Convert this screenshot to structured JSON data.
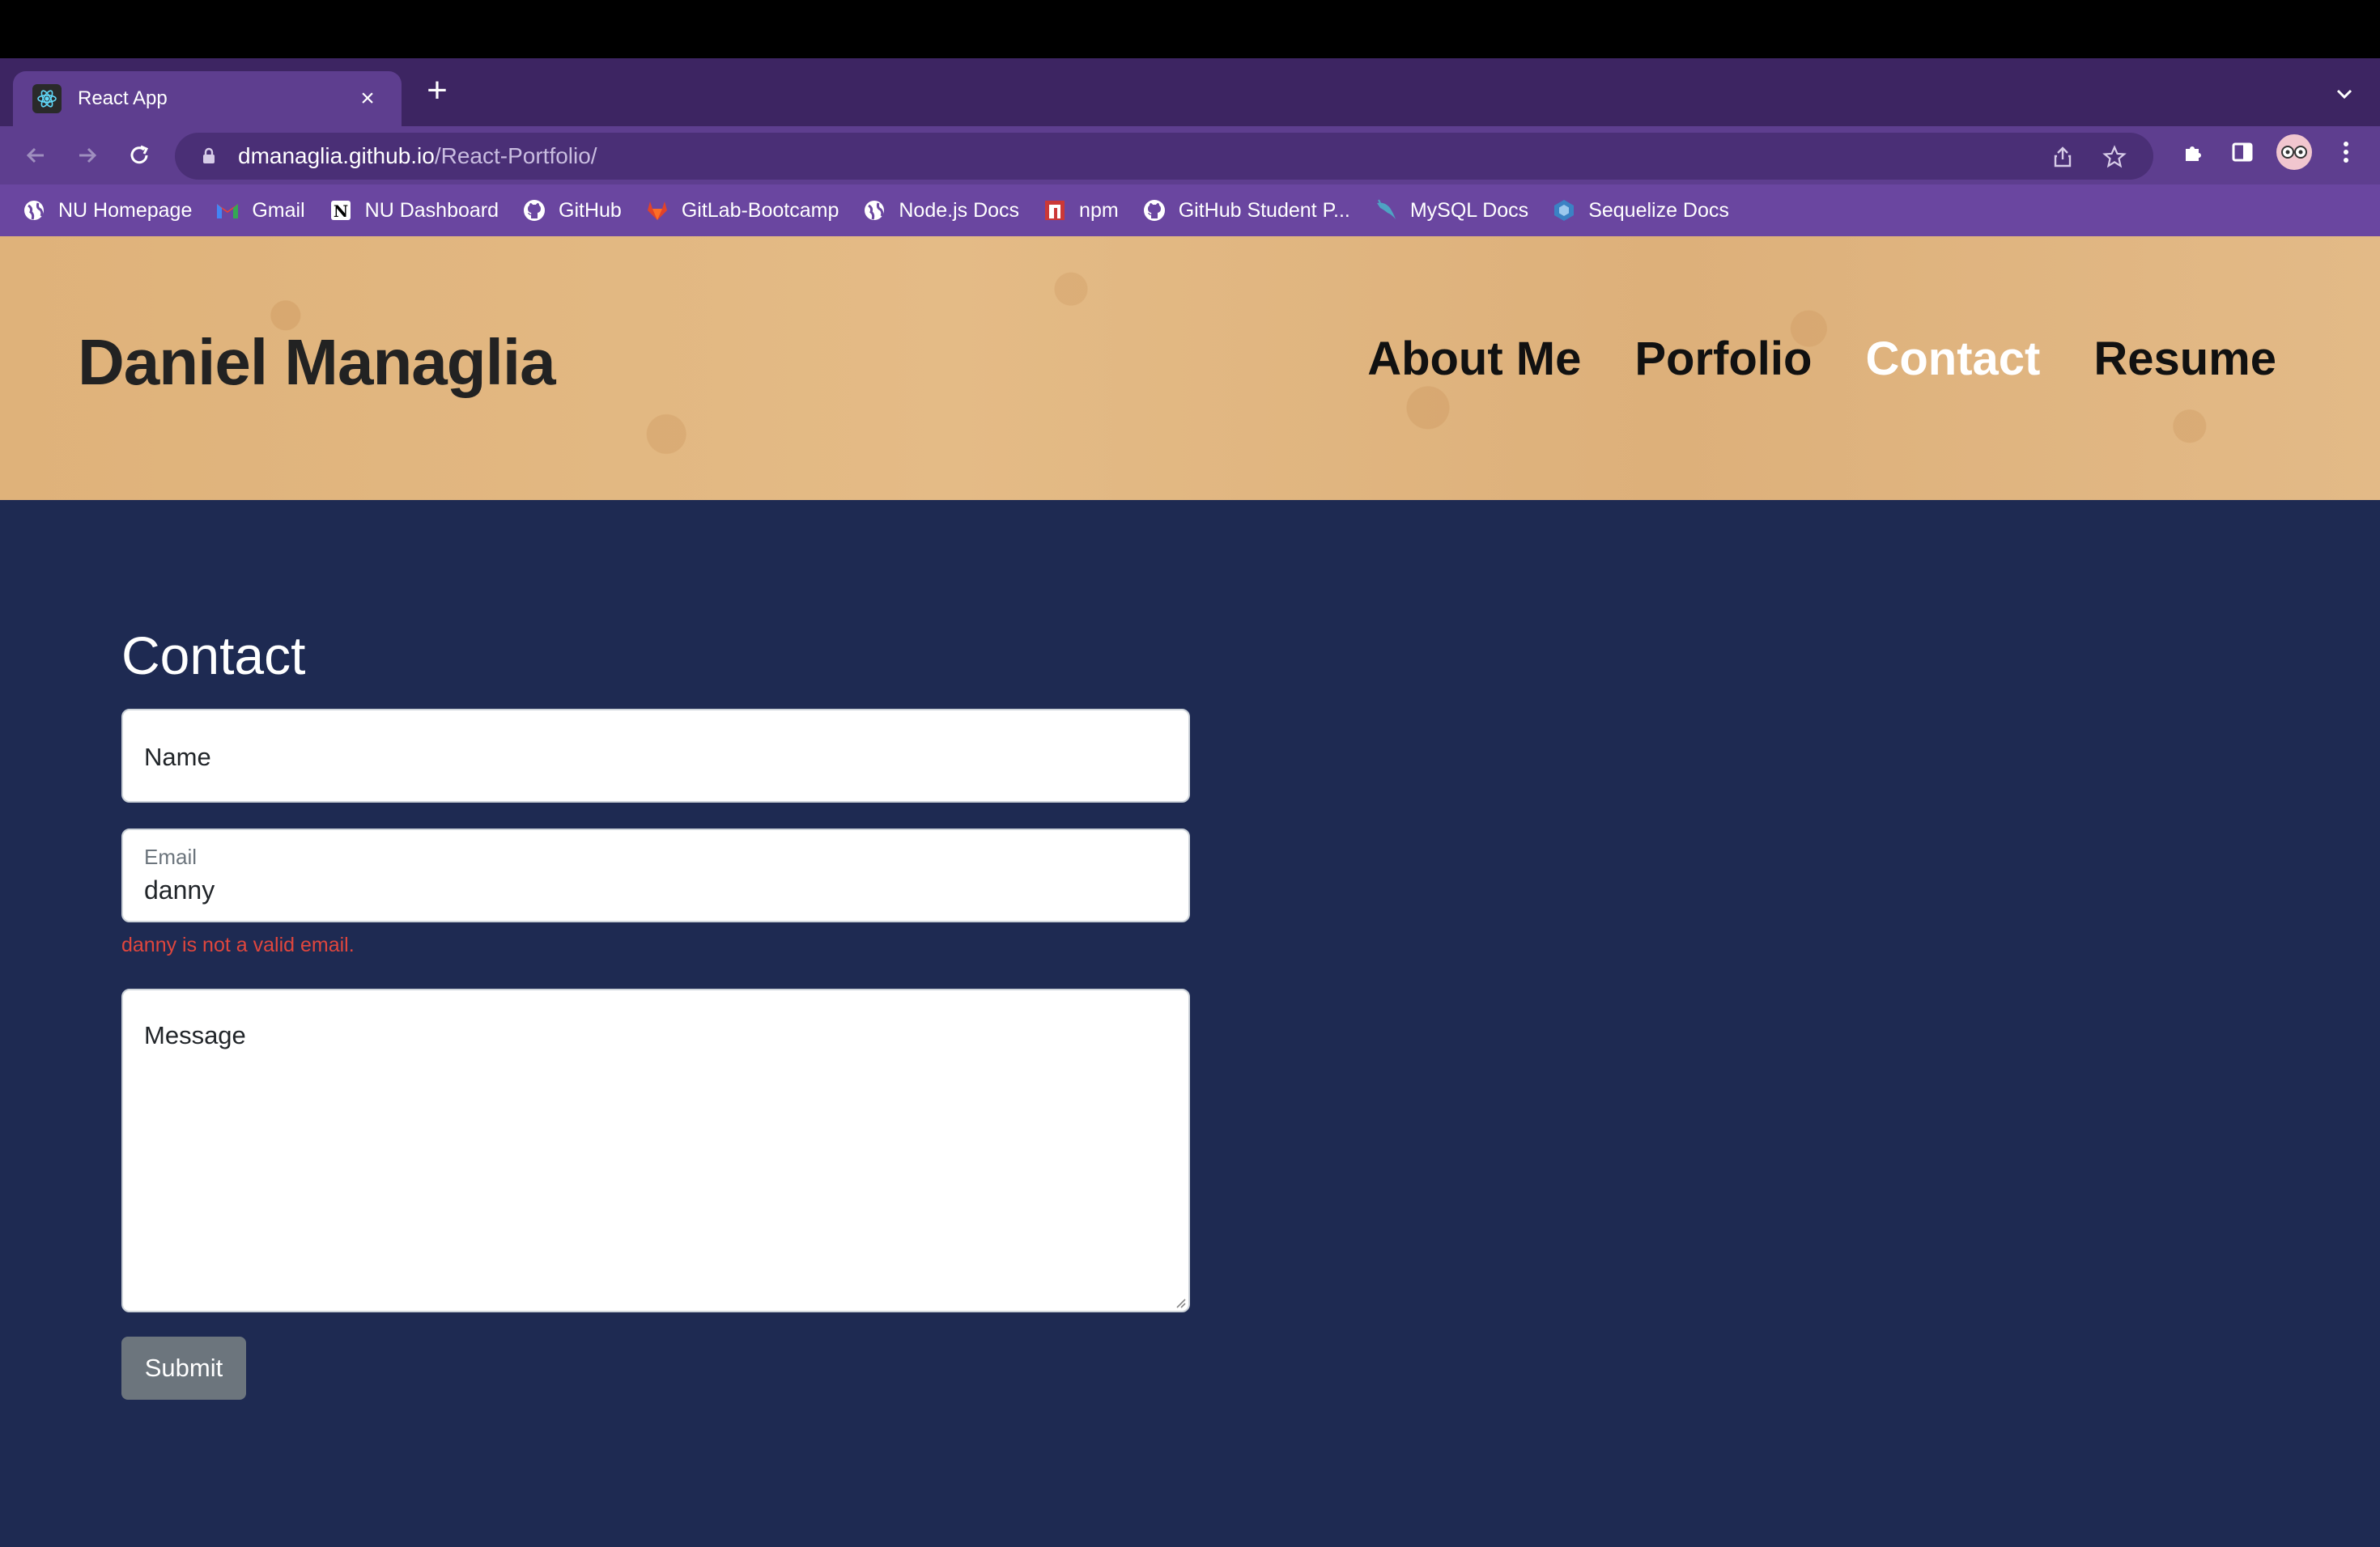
{
  "browser": {
    "tab_title": "React App",
    "close_symbol": "×",
    "new_tab_symbol": "+",
    "url_domain": "dmanaglia.github.io",
    "url_path": "/React-Portfolio/"
  },
  "bookmarks": [
    {
      "label": "NU Homepage",
      "icon": "globe-icon"
    },
    {
      "label": "Gmail",
      "icon": "gmail-icon"
    },
    {
      "label": "NU Dashboard",
      "icon": "notion-icon"
    },
    {
      "label": "GitHub",
      "icon": "github-icon"
    },
    {
      "label": "GitLab-Bootcamp",
      "icon": "gitlab-icon"
    },
    {
      "label": "Node.js Docs",
      "icon": "globe-icon"
    },
    {
      "label": "npm",
      "icon": "npm-icon"
    },
    {
      "label": "GitHub Student P...",
      "icon": "github-icon"
    },
    {
      "label": "MySQL Docs",
      "icon": "mysql-icon"
    },
    {
      "label": "Sequelize Docs",
      "icon": "sequelize-icon"
    }
  ],
  "header": {
    "site_title": "Daniel Managlia",
    "nav": [
      {
        "label": "About Me",
        "active": false
      },
      {
        "label": "Porfolio",
        "active": false
      },
      {
        "label": "Contact",
        "active": true
      },
      {
        "label": "Resume",
        "active": false
      }
    ]
  },
  "contact": {
    "heading": "Contact",
    "name_placeholder": "Name",
    "email_label": "Email",
    "email_value": "danny",
    "email_error": "danny is not a valid email.",
    "message_placeholder": "Message",
    "submit_label": "Submit"
  },
  "colors": {
    "tab_strip": "#3d2562",
    "toolbar": "#5e3e8f",
    "bookmarks_bar": "#6a46a0",
    "main_bg": "#1e2a52",
    "active_nav": "#ffffff",
    "error": "#e0463d",
    "submit_bg": "#6c757d"
  }
}
